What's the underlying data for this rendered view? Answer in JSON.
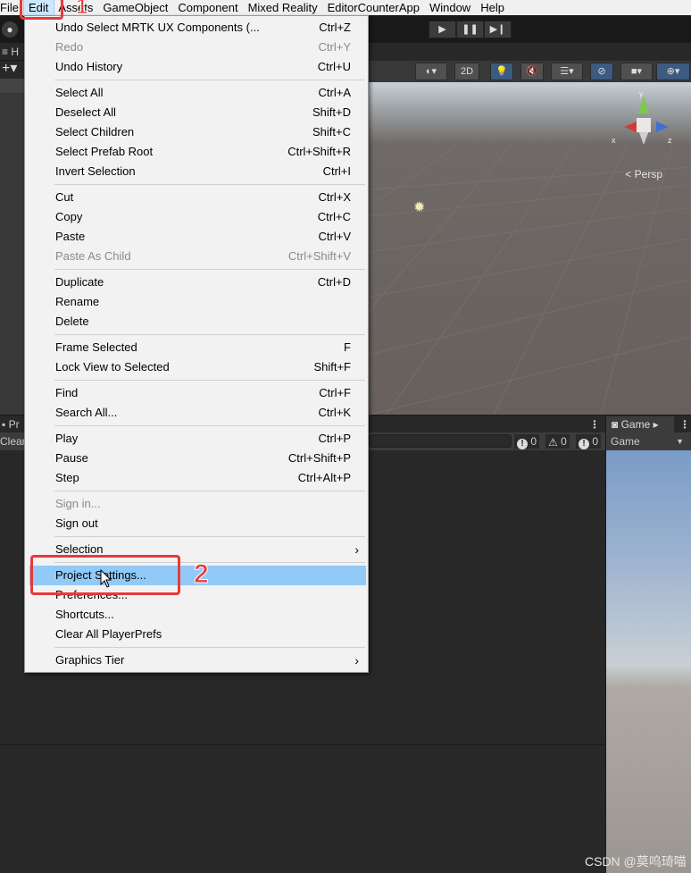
{
  "menubar": {
    "items": [
      "File",
      "Edit",
      "Assets",
      "GameObject",
      "Component",
      "Mixed Reality",
      "EditorCounterApp",
      "Window",
      "Help"
    ],
    "active": "Edit"
  },
  "edit_menu": {
    "groups": [
      [
        {
          "label": "Undo Select MRTK UX Components (...",
          "shortcut": "Ctrl+Z",
          "enabled": true
        },
        {
          "label": "Redo",
          "shortcut": "Ctrl+Y",
          "enabled": false
        },
        {
          "label": "Undo History",
          "shortcut": "Ctrl+U",
          "enabled": true
        }
      ],
      [
        {
          "label": "Select All",
          "shortcut": "Ctrl+A",
          "enabled": true
        },
        {
          "label": "Deselect All",
          "shortcut": "Shift+D",
          "enabled": true
        },
        {
          "label": "Select Children",
          "shortcut": "Shift+C",
          "enabled": true
        },
        {
          "label": "Select Prefab Root",
          "shortcut": "Ctrl+Shift+R",
          "enabled": true
        },
        {
          "label": "Invert Selection",
          "shortcut": "Ctrl+I",
          "enabled": true
        }
      ],
      [
        {
          "label": "Cut",
          "shortcut": "Ctrl+X",
          "enabled": true
        },
        {
          "label": "Copy",
          "shortcut": "Ctrl+C",
          "enabled": true
        },
        {
          "label": "Paste",
          "shortcut": "Ctrl+V",
          "enabled": true
        },
        {
          "label": "Paste As Child",
          "shortcut": "Ctrl+Shift+V",
          "enabled": false
        }
      ],
      [
        {
          "label": "Duplicate",
          "shortcut": "Ctrl+D",
          "enabled": true
        },
        {
          "label": "Rename",
          "shortcut": "",
          "enabled": true
        },
        {
          "label": "Delete",
          "shortcut": "",
          "enabled": true
        }
      ],
      [
        {
          "label": "Frame Selected",
          "shortcut": "F",
          "enabled": true
        },
        {
          "label": "Lock View to Selected",
          "shortcut": "Shift+F",
          "enabled": true
        }
      ],
      [
        {
          "label": "Find",
          "shortcut": "Ctrl+F",
          "enabled": true
        },
        {
          "label": "Search All...",
          "shortcut": "Ctrl+K",
          "enabled": true
        }
      ],
      [
        {
          "label": "Play",
          "shortcut": "Ctrl+P",
          "enabled": true
        },
        {
          "label": "Pause",
          "shortcut": "Ctrl+Shift+P",
          "enabled": true
        },
        {
          "label": "Step",
          "shortcut": "Ctrl+Alt+P",
          "enabled": true
        }
      ],
      [
        {
          "label": "Sign in...",
          "shortcut": "",
          "enabled": false
        },
        {
          "label": "Sign out",
          "shortcut": "",
          "enabled": true
        }
      ],
      [
        {
          "label": "Selection",
          "shortcut": "",
          "enabled": true,
          "submenu": true
        }
      ],
      [
        {
          "label": "Project Settings...",
          "shortcut": "",
          "enabled": true,
          "highlighted": true
        },
        {
          "label": "Preferences...",
          "shortcut": "",
          "enabled": true
        },
        {
          "label": "Shortcuts...",
          "shortcut": "",
          "enabled": true
        },
        {
          "label": "Clear All PlayerPrefs",
          "shortcut": "",
          "enabled": true
        }
      ],
      [
        {
          "label": "Graphics Tier",
          "shortcut": "",
          "enabled": true,
          "submenu": true
        }
      ]
    ]
  },
  "toolbar": {
    "play_icon": "play-icon",
    "pause_icon": "pause-icon",
    "step_icon": "step-icon"
  },
  "hierarchy": {
    "tab_label": "H",
    "add_icon": "plus-icon"
  },
  "scene": {
    "toolbar": {
      "mode_2d": "2D"
    },
    "persp_label": "Persp",
    "gizmo": {
      "x": "x",
      "y": "y",
      "z": "z"
    }
  },
  "console": {
    "tab_label": "Pr",
    "clear_label": "Clear",
    "counts": {
      "info": "0",
      "warning": "0",
      "error": "0"
    }
  },
  "game": {
    "tab_label": "Game",
    "display_label": "Game"
  },
  "annotations": {
    "step1": "1",
    "step2": "2"
  },
  "watermark": "CSDN @莫呜琦喵",
  "colors": {
    "menu_highlight": "#91c9f7",
    "annotation_red": "#e53a3a",
    "menubar_active": "#cce8ff"
  }
}
